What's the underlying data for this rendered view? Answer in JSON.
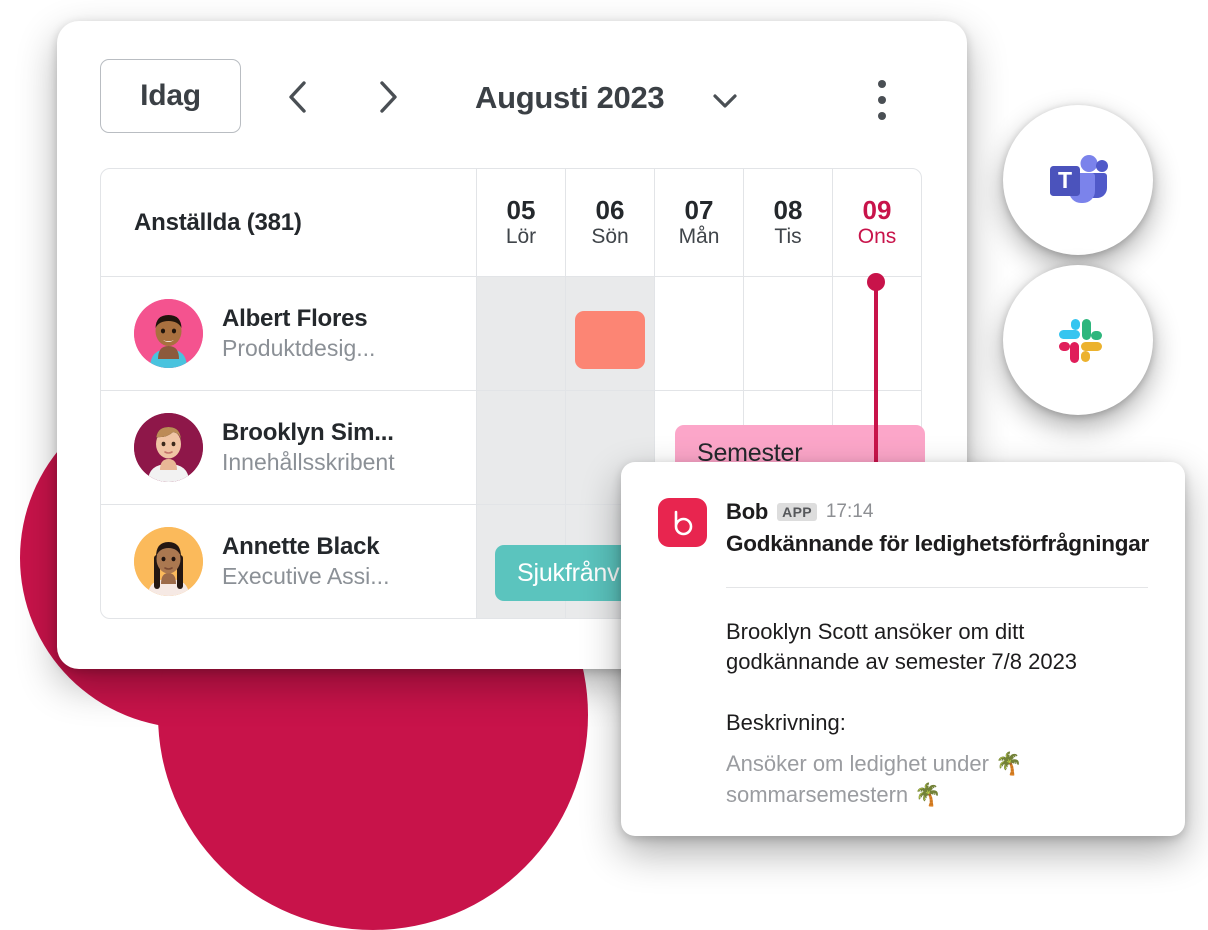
{
  "colors": {
    "accent_crimson": "#C8134A",
    "bob_red": "#E8254F",
    "vacation_pink": "#FCA6C9",
    "sick_teal": "#5BC4BE",
    "coral": "#FC8574",
    "weekend_grey": "#E9EAEB",
    "text_dark": "#24282C",
    "text_muted": "#8B9096"
  },
  "toolbar": {
    "today_label": "Idag",
    "prev_icon": "chevron-left-icon",
    "next_icon": "chevron-right-icon",
    "month_label": "Augusti 2023",
    "month_dropdown_icon": "chevron-down-icon",
    "overflow_icon": "kebab-menu-icon"
  },
  "calendar": {
    "employees_header": "Anställda (381)",
    "days": [
      {
        "num": "05",
        "name": "Lör",
        "weekend": true,
        "today": false
      },
      {
        "num": "06",
        "name": "Sön",
        "weekend": true,
        "today": false
      },
      {
        "num": "07",
        "name": "Mån",
        "weekend": false,
        "today": false
      },
      {
        "num": "08",
        "name": "Tis",
        "weekend": false,
        "today": false
      },
      {
        "num": "09",
        "name": "Ons",
        "weekend": false,
        "today": true
      }
    ],
    "rows": [
      {
        "name": "Albert Flores",
        "role": "Produktdesig...",
        "avatar_bg": "#F4538F"
      },
      {
        "name": "Brooklyn Sim...",
        "role": "Innehållsskribent",
        "avatar_bg": "#8E1749"
      },
      {
        "name": "Annette Black",
        "role": "Executive Assi...",
        "avatar_bg": "#FBBA5B"
      }
    ],
    "events": [
      {
        "id": "chip-small",
        "label": "",
        "color": "#FC8574"
      },
      {
        "id": "chip-vacation",
        "label": "Semester",
        "color": "#FCA6C9"
      },
      {
        "id": "chip-sick",
        "label": "Sjukfrånv",
        "color": "#5BC4BE"
      }
    ]
  },
  "integrations": [
    {
      "name": "microsoft-teams",
      "icon": "teams-icon"
    },
    {
      "name": "slack",
      "icon": "slack-icon"
    }
  ],
  "notification": {
    "app_logo": "bob-logo-icon",
    "sender": "Bob",
    "badge": "APP",
    "time": "17:14",
    "title": "Godkännande för ledighetsförfrågningar",
    "body": "Brooklyn Scott ansöker om ditt godkännande av semester 7/8 2023",
    "description_label": "Beskrivning:",
    "description": "Ansöker om ledighet under 🌴 sommarsemestern 🌴"
  }
}
